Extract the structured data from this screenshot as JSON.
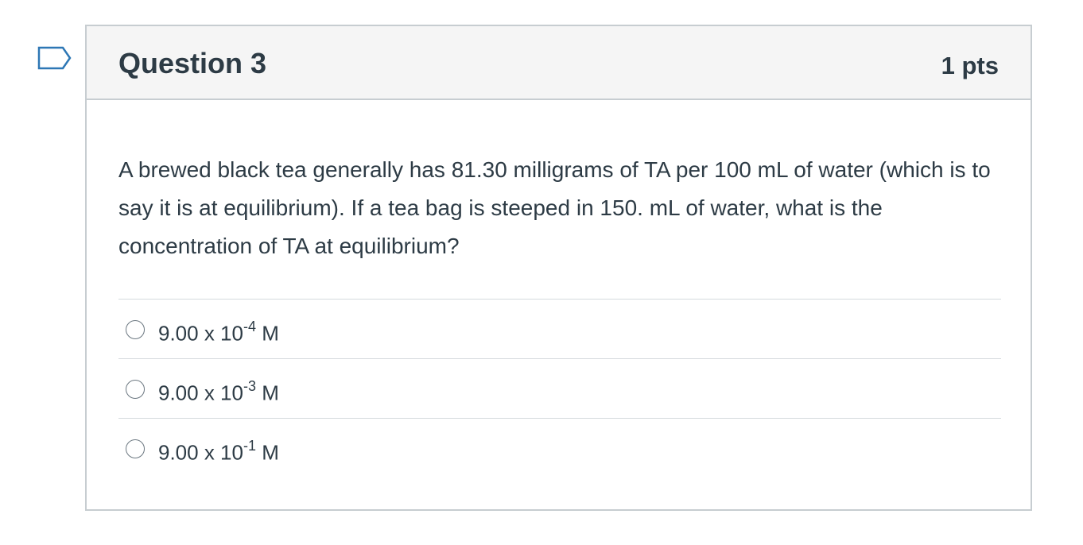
{
  "question": {
    "title": "Question 3",
    "points": "1 pts",
    "text": "A brewed black tea generally has 81.30 milligrams of TA per 100 mL of water (which is to say it is at equilibrium). If a tea bag is steeped in 150. mL of water, what is the concentration of TA at equilibrium?",
    "answers": [
      {
        "base": "9.00 x 10",
        "exponent": "-4",
        "unit": " M"
      },
      {
        "base": "9.00 x 10",
        "exponent": "-3",
        "unit": " M"
      },
      {
        "base": "9.00 x 10",
        "exponent": "-1",
        "unit": " M"
      }
    ]
  },
  "icons": {
    "flag": "flag-question-icon",
    "radio": "radio-unselected-icon"
  },
  "colors": {
    "text": "#2d3b45",
    "header_bg": "#f5f5f5",
    "border": "#c7cdd1",
    "flag_stroke": "#2d77b5"
  }
}
